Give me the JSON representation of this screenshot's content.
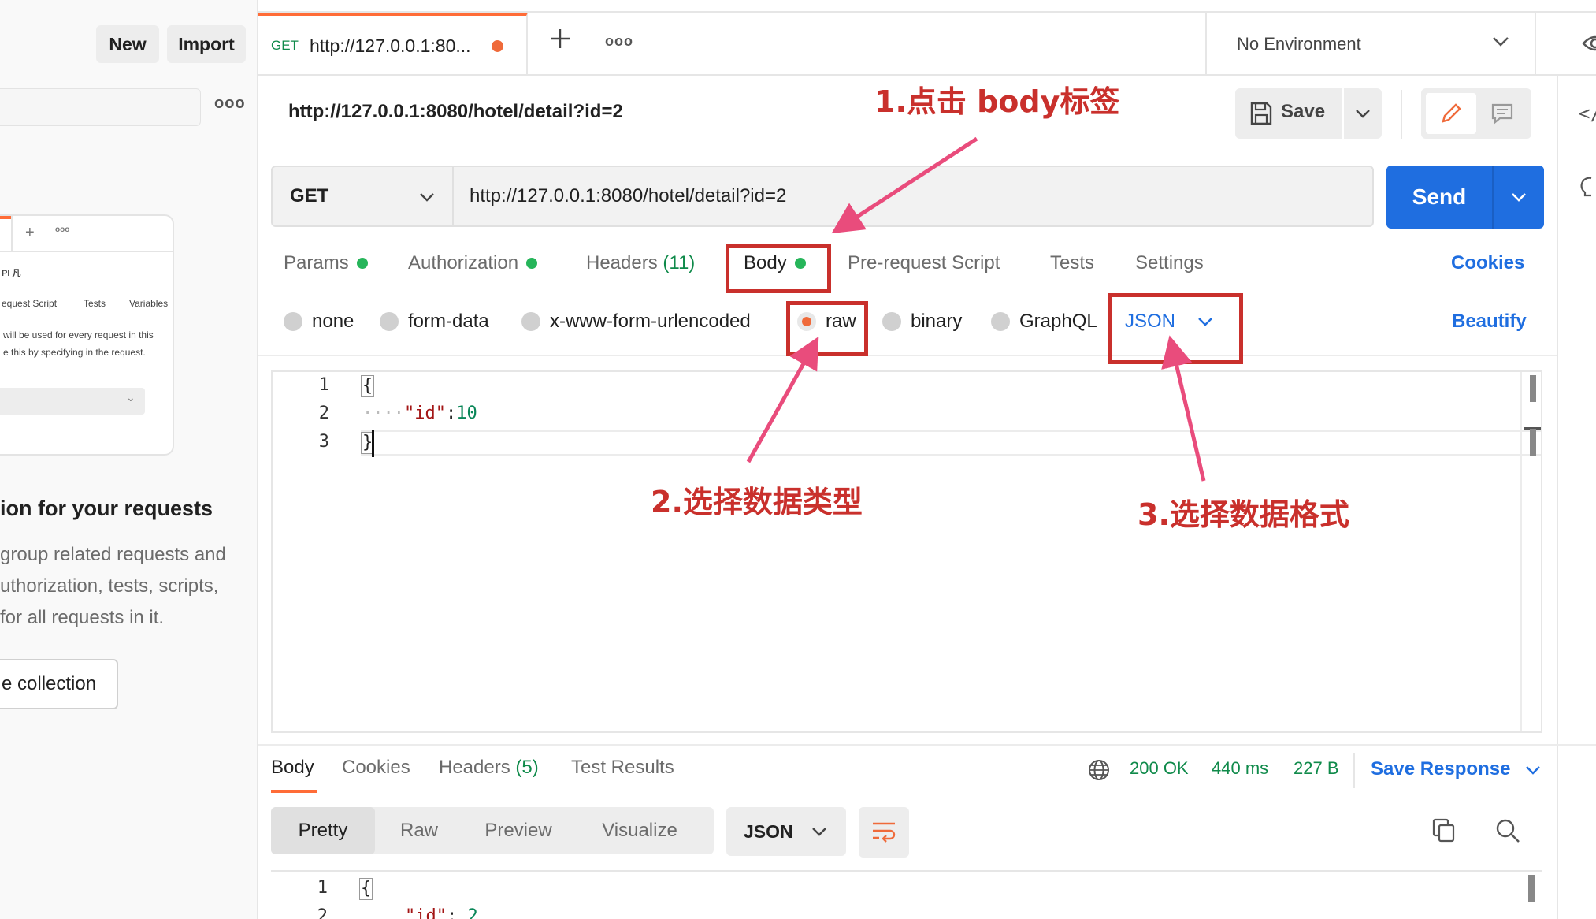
{
  "sidebar": {
    "new_label": "New",
    "import_label": "Import",
    "preview": {
      "tab_fragment": "PI 凡",
      "col1": "equest Script",
      "col2": "Tests",
      "col3": "Variables",
      "line1": "will be used for every request in this",
      "line2": "e this by specifying in the request."
    },
    "heading": "ion for your requests",
    "para_lines": [
      "group related requests and",
      "uthorization, tests, scripts,",
      "for all requests in it."
    ],
    "create_label": "e collection"
  },
  "tabbar": {
    "method": "GET",
    "url": "http://127.0.0.1:80...",
    "environment": "No Environment"
  },
  "request": {
    "name": "http://127.0.0.1:8080/hotel/detail?id=2",
    "save_label": "Save",
    "method": "GET",
    "url": "http://127.0.0.1:8080/hotel/detail?id=2",
    "send_label": "Send",
    "tabs": {
      "params": "Params",
      "authorization": "Authorization",
      "headers": "Headers",
      "headers_count": "(11)",
      "body": "Body",
      "prerequest": "Pre-request Script",
      "tests": "Tests",
      "settings": "Settings"
    },
    "cookies_label": "Cookies",
    "body_types": {
      "none": "none",
      "form_data": "form-data",
      "urlencoded": "x-www-form-urlencoded",
      "raw": "raw",
      "binary": "binary",
      "graphql": "GraphQL"
    },
    "body_format": "JSON",
    "beautify_label": "Beautify",
    "editor": {
      "line_numbers": [
        "1",
        "2",
        "3"
      ],
      "line1": "{",
      "indent": "····",
      "key": "\"id\"",
      "colon": ":",
      "value": "10",
      "line3": "}"
    }
  },
  "annotations": {
    "step1": "1.点击 body标签",
    "step2": "2.选择数据类型",
    "step3": "3.选择数据格式"
  },
  "response": {
    "tabs": {
      "body": "Body",
      "cookies": "Cookies",
      "headers": "Headers",
      "headers_count": "(5)",
      "test_results": "Test Results"
    },
    "status": "200 OK",
    "time": "440 ms",
    "size": "227 B",
    "save_response": "Save Response",
    "formats": [
      "Pretty",
      "Raw",
      "Preview",
      "Visualize"
    ],
    "format_selected": "JSON",
    "editor": {
      "line_numbers": [
        "1",
        "2"
      ],
      "line1": "{",
      "key": "\"id\"",
      "colon": ":",
      "value": "2"
    }
  },
  "colors": {
    "accent_orange": "#ff6c37",
    "send_blue": "#1f6ee0",
    "status_green": "#0f8a4a",
    "annotation_red": "#c9302c",
    "arrow_pink": "#e94c7c"
  }
}
